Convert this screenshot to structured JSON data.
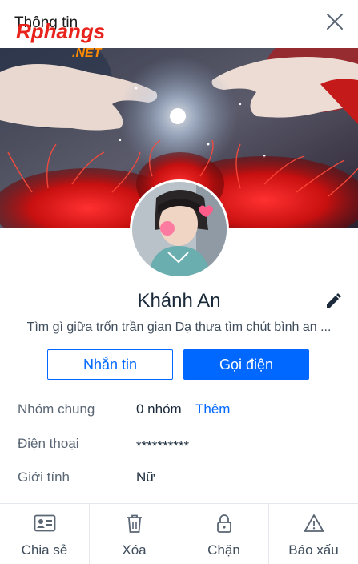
{
  "header": {
    "title": "Thông tin"
  },
  "watermark": {
    "brand": "Rphangs",
    "suffix": ".NET"
  },
  "profile": {
    "name": "Khánh An",
    "status": "Tìm gì giữa trốn trần gian Dạ thưa tìm chút bình an ..."
  },
  "buttons": {
    "message": "Nhắn tin",
    "call": "Gọi điện"
  },
  "info": {
    "groups": {
      "label": "Nhóm chung",
      "value": "0 nhóm",
      "link": "Thêm"
    },
    "phone": {
      "label": "Điện thoại",
      "value": "**********"
    },
    "gender": {
      "label": "Giới tính",
      "value": "Nữ"
    }
  },
  "actions": [
    {
      "label": "Chia sẻ",
      "icon": "contact-card-icon"
    },
    {
      "label": "Xóa",
      "icon": "trash-icon"
    },
    {
      "label": "Chặn",
      "icon": "lock-icon"
    },
    {
      "label": "Báo xấu",
      "icon": "warning-icon"
    }
  ],
  "colors": {
    "accent": "#0068ff",
    "text": "#1b2a3a",
    "muted": "#5a6674"
  }
}
